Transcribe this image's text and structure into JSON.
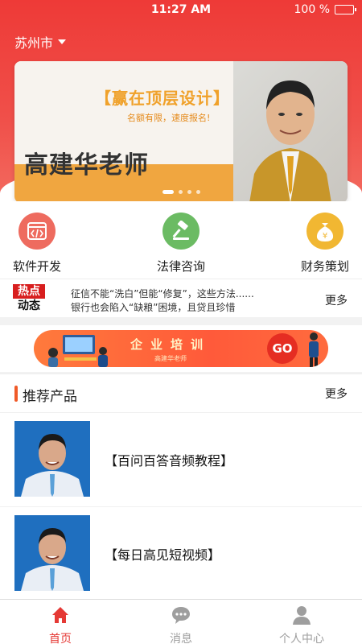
{
  "status": {
    "time": "11:27 AM",
    "battery": "100 %"
  },
  "location": {
    "city": "苏州市"
  },
  "banner": {
    "headline": "【赢在顶层设计】",
    "subline": "名额有限，速度报名!",
    "teacher": "高建华老师",
    "slides": 4,
    "active_slide": 1
  },
  "quicknav": [
    {
      "label": "软件开发",
      "icon": "code-window-icon",
      "color": "#ee6b5f"
    },
    {
      "label": "法律咨询",
      "icon": "gavel-icon",
      "color": "#6bbb63"
    },
    {
      "label": "财务策划",
      "icon": "money-bag-icon",
      "color": "#f1b732"
    }
  ],
  "hot": {
    "logo_top": "热点",
    "logo_bottom": "动态",
    "lines": [
      "征信不能“洗白”但能“修复”，这些方法......",
      "银行也会陷入“缺粮”困境，且贷且珍惜"
    ],
    "more": "更多"
  },
  "ad": {
    "text": "企业培训",
    "small": "高建华老师",
    "go": "GO"
  },
  "recommend": {
    "title": "推荐产品",
    "more": "更多"
  },
  "products": [
    {
      "title": "【百问百答音频教程】"
    },
    {
      "title": "【每日高见短视频】"
    }
  ],
  "tabs": [
    {
      "label": "首页",
      "icon": "home-icon",
      "active": true
    },
    {
      "label": "消息",
      "icon": "message-icon",
      "active": false
    },
    {
      "label": "个人中心",
      "icon": "user-icon",
      "active": false
    }
  ],
  "colors": {
    "accent": "#ee3a37",
    "tab_active": "#e53935",
    "tab_inactive": "#9e9e9e"
  }
}
